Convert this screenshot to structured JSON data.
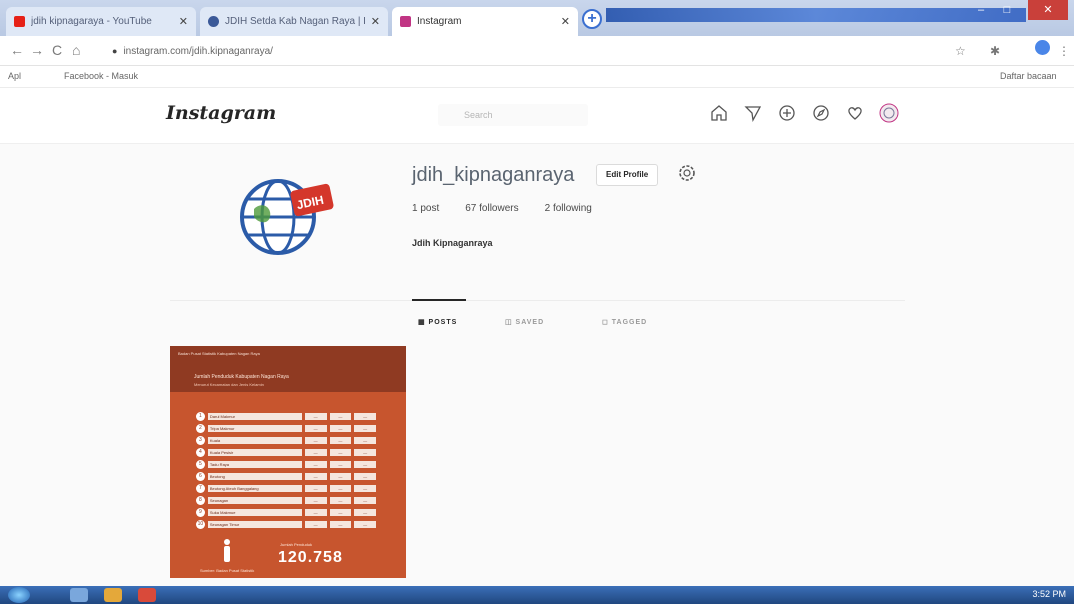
{
  "browser": {
    "tabs": [
      {
        "title": "jdih kipnagaraya - YouTube",
        "favicon_color": "#e62117"
      },
      {
        "title": "JDIH Setda Kab Nagan Raya | Facebook",
        "favicon_color": "#3b5998"
      },
      {
        "title": "Instagram",
        "favicon_color": "#c13584"
      }
    ],
    "new_tab_glyph": "+",
    "window_controls": {
      "minimize": "–",
      "maximize": "□",
      "close": "✕"
    },
    "url": "instagram.com/jdih.kipnaganraya/",
    "nav_icons": {
      "back": "←",
      "forward": "→",
      "reload": "C",
      "home": "⌂"
    },
    "toolbar_icons": {
      "bookmark": "☆",
      "extensions": "✱",
      "menu": "⋮"
    },
    "bookmarks": [
      {
        "label": "Apl"
      },
      {
        "label": "Facebook - Masuk"
      }
    ],
    "reading_list": "Daftar bacaan"
  },
  "instagram": {
    "logo": "Instagram",
    "search_placeholder": "Search",
    "profile": {
      "username": "jdih_kipnaganraya",
      "edit_button": "Edit Profile",
      "posts": "1 post",
      "followers": "67 followers",
      "following": "2 following",
      "full_name": "Jdih Kipnaganraya"
    },
    "tabs": [
      {
        "label": "▦ POSTS"
      },
      {
        "label": "◫ SAVED"
      },
      {
        "label": "◻ TAGGED"
      }
    ],
    "post": {
      "header": "Badan Pusat Statistik Kabupaten Nagan Raya",
      "title": "Jumlah Penduduk Kabupaten Nagan Raya",
      "subtitle": "Menurut Kecamatan dan Jenis Kelamin",
      "rows": [
        {
          "n": "1",
          "name": "Darul Makmur",
          "a": "—",
          "b": "—",
          "c": "—"
        },
        {
          "n": "2",
          "name": "Tripa Makmur",
          "a": "—",
          "b": "—",
          "c": "—"
        },
        {
          "n": "3",
          "name": "Kuala",
          "a": "—",
          "b": "—",
          "c": "—"
        },
        {
          "n": "4",
          "name": "Kuala Pesisir",
          "a": "—",
          "b": "—",
          "c": "—"
        },
        {
          "n": "5",
          "name": "Tadu Raya",
          "a": "—",
          "b": "—",
          "c": "—"
        },
        {
          "n": "6",
          "name": "Beutong",
          "a": "—",
          "b": "—",
          "c": "—"
        },
        {
          "n": "7",
          "name": "Beutong Ateuh Banggalang",
          "a": "—",
          "b": "—",
          "c": "—"
        },
        {
          "n": "8",
          "name": "Seunagan",
          "a": "—",
          "b": "—",
          "c": "—"
        },
        {
          "n": "9",
          "name": "Suka Makmue",
          "a": "—",
          "b": "—",
          "c": "—"
        },
        {
          "n": "10",
          "name": "Seunagan Timur",
          "a": "—",
          "b": "—",
          "c": "—"
        }
      ],
      "total_label": "Jumlah Penduduk",
      "total": "120.758",
      "footer": "Sumber: Badan Pusat Statistik"
    }
  },
  "taskbar": {
    "clock": "3:52 PM"
  },
  "colors": {
    "post_bg": "#c7552e",
    "accent_blue": "#0095f6"
  }
}
